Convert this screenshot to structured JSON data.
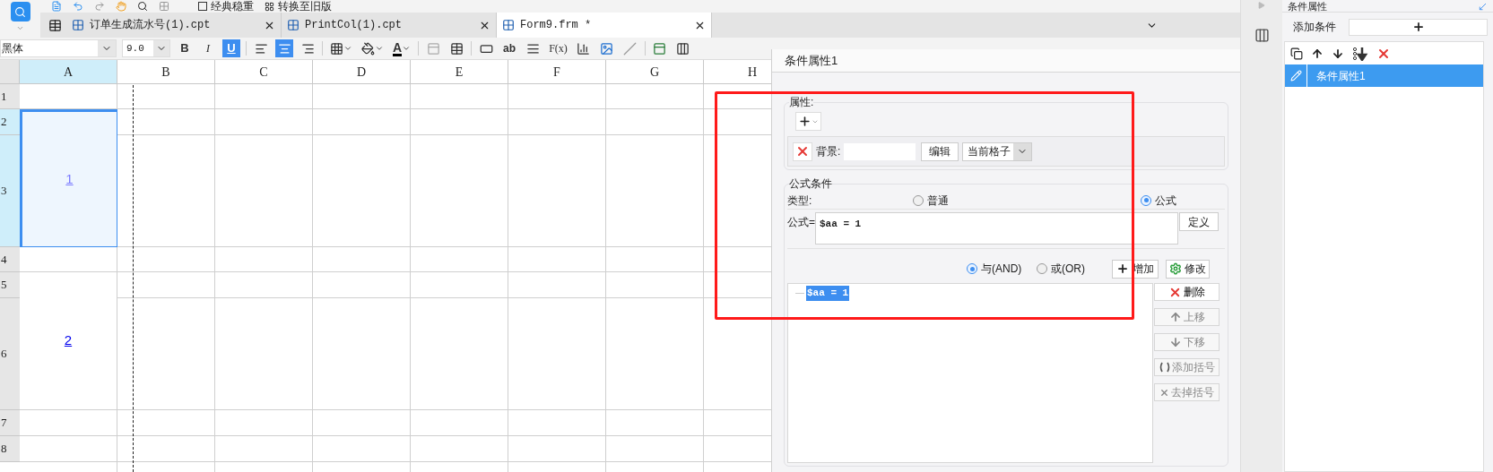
{
  "app_menu": {
    "items": [
      {
        "label": "经典稳重"
      },
      {
        "label": "转换至旧版"
      }
    ]
  },
  "tabs": [
    {
      "label": "订单生成流水号(1).cpt",
      "selected": false
    },
    {
      "label": "PrintCol(1).cpt",
      "selected": false
    },
    {
      "label": "Form9.frm *",
      "selected": true
    }
  ],
  "format_toolbar": {
    "font": "黑体",
    "size": "9.0",
    "styles": [
      {
        "label": "B",
        "selected": false
      },
      {
        "label": "I",
        "selected": false
      },
      {
        "label": "U",
        "selected": true
      }
    ],
    "alignment": [
      {
        "kind": "left",
        "selected": false
      },
      {
        "kind": "center",
        "selected": true
      },
      {
        "kind": "right",
        "selected": false
      }
    ],
    "font_color": "A",
    "text_tool": "ab",
    "formula_tool": "F(x)"
  },
  "sheet": {
    "columns": [
      {
        "label": "A",
        "selected": true
      },
      {
        "label": "B",
        "selected": false
      },
      {
        "label": "C",
        "selected": false
      },
      {
        "label": "D",
        "selected": false
      },
      {
        "label": "E",
        "selected": false
      },
      {
        "label": "F",
        "selected": false
      },
      {
        "label": "G",
        "selected": false
      },
      {
        "label": "H",
        "selected": false
      }
    ],
    "rows": [
      {
        "label": "1",
        "selected": false
      },
      {
        "label": "2",
        "selected": true
      },
      {
        "label": "3",
        "selected": true
      },
      {
        "label": "4",
        "selected": false
      },
      {
        "label": "5",
        "selected": false
      },
      {
        "label": "6",
        "selected": false
      },
      {
        "label": "7",
        "selected": false
      },
      {
        "label": "8",
        "selected": false
      }
    ],
    "cells": [
      {
        "text": "1",
        "selected": true
      },
      {
        "text": "2",
        "selected": false
      }
    ]
  },
  "condition_dialog": {
    "title": "条件属性1",
    "properties": {
      "label": "属性:",
      "attributes": [
        {
          "label": "背景:",
          "edit_button": "编辑",
          "scope": "当前格子"
        }
      ]
    },
    "formula_condition": {
      "title": "公式条件",
      "type_label": "类型:",
      "types": [
        {
          "label": "普通",
          "selected": false
        },
        {
          "label": "公式",
          "selected": true
        }
      ],
      "formula_label": "公式=",
      "formula": "$aa = 1",
      "define_button": "定义",
      "logic": [
        {
          "label": "与(AND)",
          "selected": true
        },
        {
          "label": "或(OR)",
          "selected": false
        }
      ],
      "add_button": "增加",
      "modify_button": "修改",
      "conditions": [
        {
          "text": "$aa = 1",
          "selected": true
        }
      ],
      "actions": [
        {
          "label": "删除",
          "kind": "delete",
          "disabled": false
        },
        {
          "label": "上移",
          "kind": "up",
          "disabled": true
        },
        {
          "label": "下移",
          "kind": "down",
          "disabled": true
        },
        {
          "label": "添加括号",
          "kind": "add-paren",
          "disabled": true
        },
        {
          "label": "去掉括号",
          "kind": "remove-paren",
          "disabled": true
        }
      ]
    }
  },
  "side_panel": {
    "title": "条件属性",
    "add_label": "添加条件",
    "conditions": [
      {
        "label": "条件属性1",
        "selected": true
      }
    ]
  }
}
